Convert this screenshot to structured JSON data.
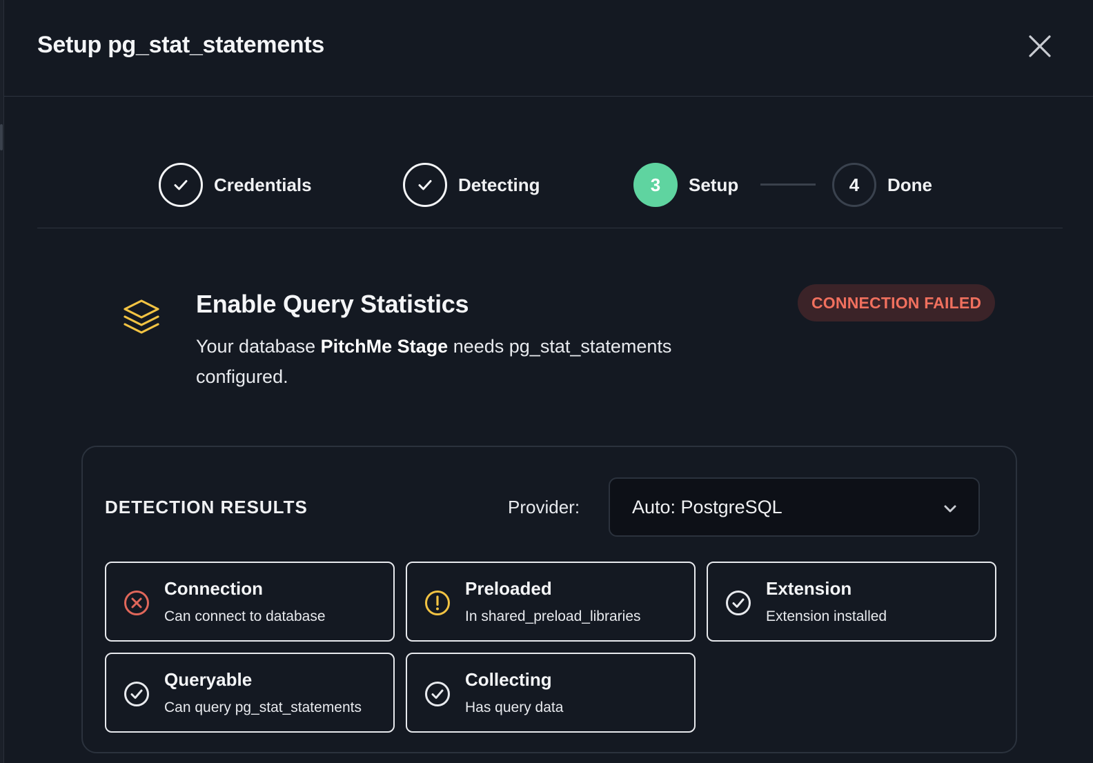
{
  "modal": {
    "title": "Setup pg_stat_statements"
  },
  "stepper": {
    "steps": [
      {
        "label": "Credentials",
        "state": "done",
        "marker": ""
      },
      {
        "label": "Detecting",
        "state": "done",
        "marker": ""
      },
      {
        "label": "Setup",
        "state": "active",
        "marker": "3"
      },
      {
        "label": "Done",
        "state": "pending",
        "marker": "4"
      }
    ]
  },
  "intro": {
    "heading": "Enable Query Statistics",
    "text_prefix": "Your database ",
    "db_name": "PitchMe Stage",
    "text_suffix": " needs pg_stat_statements configured.",
    "status_badge": "CONNECTION FAILED",
    "icon": "layers-icon"
  },
  "detection": {
    "title": "DETECTION RESULTS",
    "provider_label": "Provider:",
    "provider_value": "Auto: PostgreSQL",
    "results": [
      {
        "title": "Connection",
        "desc": "Can connect to database",
        "status": "failed",
        "icon": "x-circle-icon"
      },
      {
        "title": "Preloaded",
        "desc": "In shared_preload_libraries",
        "status": "warning",
        "icon": "alert-circle-icon"
      },
      {
        "title": "Extension",
        "desc": "Extension installed",
        "status": "ok",
        "icon": "check-circle-icon"
      },
      {
        "title": "Queryable",
        "desc": "Can query pg_stat_statements",
        "status": "ok",
        "icon": "check-circle-icon"
      },
      {
        "title": "Collecting",
        "desc": "Has query data",
        "status": "ok",
        "icon": "check-circle-icon"
      }
    ]
  },
  "colors": {
    "accent_green": "#5fd4a0",
    "failed_red": "#e0675a",
    "warning_yellow": "#f2c343",
    "badge_bg": "#3b2328",
    "badge_text": "#f0705e"
  }
}
